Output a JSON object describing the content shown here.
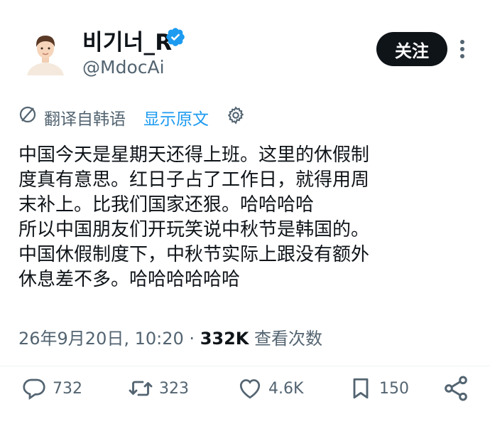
{
  "author": {
    "name": "비기너_R",
    "handle": "@MdocAi",
    "verified": true,
    "verified_color": "#1d9bf0"
  },
  "follow_label": "关注",
  "translation": {
    "translated_from": "翻译自韩语",
    "show_original": "显示原文"
  },
  "tweet_lines": [
    "中国今天是星期天还得上班。这里的休假制",
    "度真有意思。红日子占了工作日，就得用周",
    "末补上。比我们国家还狠。哈哈哈哈",
    "所以中国朋友们开玩笑说中秋节是韩国的。",
    "中国休假制度下，中秋节实际上跟没有额外",
    "休息差不多。哈哈哈哈哈哈"
  ],
  "meta": {
    "timestamp": "26年9月20日, 10:20",
    "separator": "·",
    "views_count": "332K",
    "views_label": "查看次数"
  },
  "actions": {
    "replies": "732",
    "reposts": "323",
    "likes": "4.6K",
    "bookmarks": "150"
  },
  "colors": {
    "text": "#0f1419",
    "secondary": "#536471",
    "link": "#1d9bf0"
  }
}
